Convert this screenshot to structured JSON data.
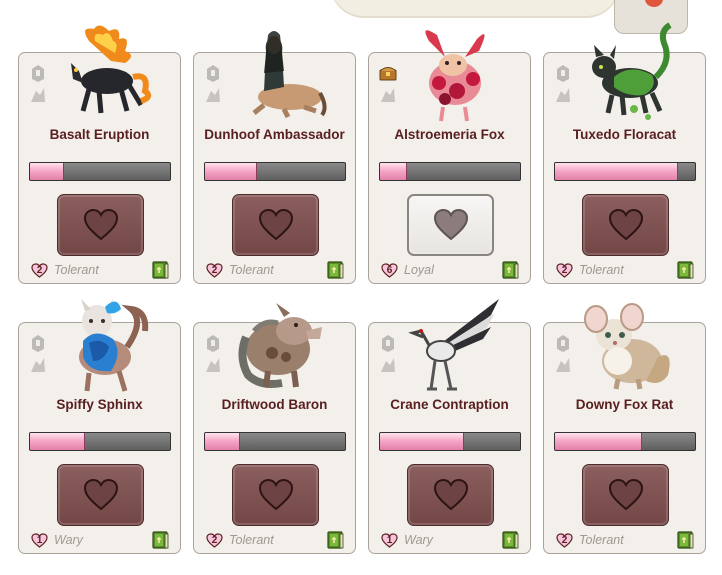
{
  "colors": {
    "name_text": "#5a2020",
    "bar_fill": "#f2a0c3",
    "button_brown": "#7e5252",
    "card_bg": "#f3f0ec"
  },
  "familiars": [
    {
      "name": "Basalt Eruption",
      "progress": 0.24,
      "level": "2",
      "bond": "Tolerant",
      "bonded_today": false,
      "icon": "fire-wolf-sprite"
    },
    {
      "name": "Dunhoof Ambassador",
      "progress": 0.37,
      "level": "2",
      "bond": "Tolerant",
      "bonded_today": false,
      "icon": "centaur-sprite"
    },
    {
      "name": "Alstroemeria Fox",
      "progress": 0.19,
      "level": "6",
      "bond": "Loyal",
      "bonded_today": true,
      "icon": "flower-fox-sprite"
    },
    {
      "name": "Tuxedo Floracat",
      "progress": 0.88,
      "level": "2",
      "bond": "Tolerant",
      "bonded_today": false,
      "icon": "leaf-cat-sprite"
    },
    {
      "name": "Spiffy Sphinx",
      "progress": 0.39,
      "level": "1",
      "bond": "Wary",
      "bonded_today": false,
      "icon": "sphinx-sprite"
    },
    {
      "name": "Driftwood Baron",
      "progress": 0.25,
      "level": "2",
      "bond": "Tolerant",
      "bonded_today": false,
      "icon": "boar-sprite"
    },
    {
      "name": "Crane Contraption",
      "progress": 0.6,
      "level": "1",
      "bond": "Wary",
      "bonded_today": false,
      "icon": "mechanical-crane-sprite"
    },
    {
      "name": "Downy Fox Rat",
      "progress": 0.62,
      "level": "2",
      "bond": "Tolerant",
      "bonded_today": false,
      "icon": "fox-rat-sprite"
    }
  ]
}
